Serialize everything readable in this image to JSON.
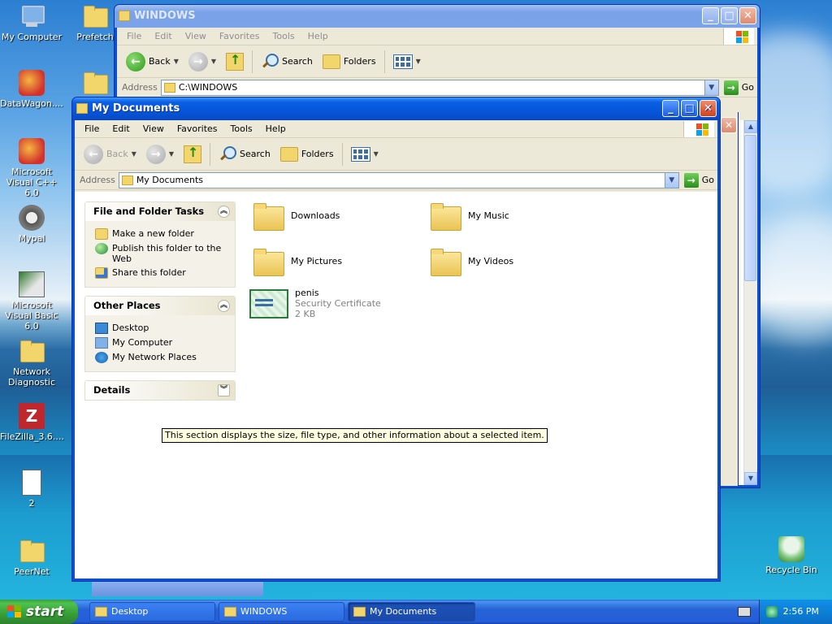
{
  "desktop": {
    "icons": [
      {
        "label": "My Computer",
        "icon": "computer-icon"
      },
      {
        "label": "DataWagon....",
        "icon": "app-icon"
      },
      {
        "label": "Microsoft Visual C++ 6.0",
        "icon": "visual-cpp-icon"
      },
      {
        "label": "Mypal",
        "icon": "raccoon-icon"
      },
      {
        "label": "Microsoft Visual Basic 6.0",
        "icon": "visual-basic-icon"
      },
      {
        "label": "Network Diagnostic",
        "icon": "folder-icon"
      },
      {
        "label": "FileZilla_3.6....",
        "icon": "filezilla-icon"
      },
      {
        "label": "2",
        "icon": "document-icon"
      },
      {
        "label": "PeerNet",
        "icon": "folder-icon"
      },
      {
        "label": "Prefetch",
        "icon": "folder-icon"
      },
      {
        "label": "Recycle Bin",
        "icon": "recycle-bin-icon"
      }
    ]
  },
  "back_window": {
    "title": "WINDOWS",
    "menu": [
      "File",
      "Edit",
      "View",
      "Favorites",
      "Tools",
      "Help"
    ],
    "toolbar": {
      "back": "Back",
      "search": "Search",
      "folders": "Folders"
    },
    "address_label": "Address",
    "address_value": "C:\\WINDOWS",
    "go_label": "Go"
  },
  "front_window": {
    "title": "My Documents",
    "menu": [
      "File",
      "Edit",
      "View",
      "Favorites",
      "Tools",
      "Help"
    ],
    "toolbar": {
      "back": "Back",
      "search": "Search",
      "folders": "Folders"
    },
    "address_label": "Address",
    "address_value": "My Documents",
    "go_label": "Go",
    "tasks": {
      "file_folder": {
        "title": "File and Folder Tasks",
        "links": [
          "Make a new folder",
          "Publish this folder to the Web",
          "Share this folder"
        ]
      },
      "other_places": {
        "title": "Other Places",
        "links": [
          "Desktop",
          "My Computer",
          "My Network Places"
        ]
      },
      "details": {
        "title": "Details"
      }
    },
    "files": [
      {
        "name": "Downloads"
      },
      {
        "name": "My Music"
      },
      {
        "name": "My Pictures"
      },
      {
        "name": "My Videos"
      },
      {
        "name": "penis",
        "type": "Security Certificate",
        "size": "2 KB"
      }
    ],
    "tooltip": "This section displays the size, file type, and other information about a selected item."
  },
  "taskbar": {
    "start_label": "start",
    "tasks": [
      "Desktop",
      "WINDOWS",
      "My Documents"
    ],
    "clock": "2:56 PM"
  }
}
